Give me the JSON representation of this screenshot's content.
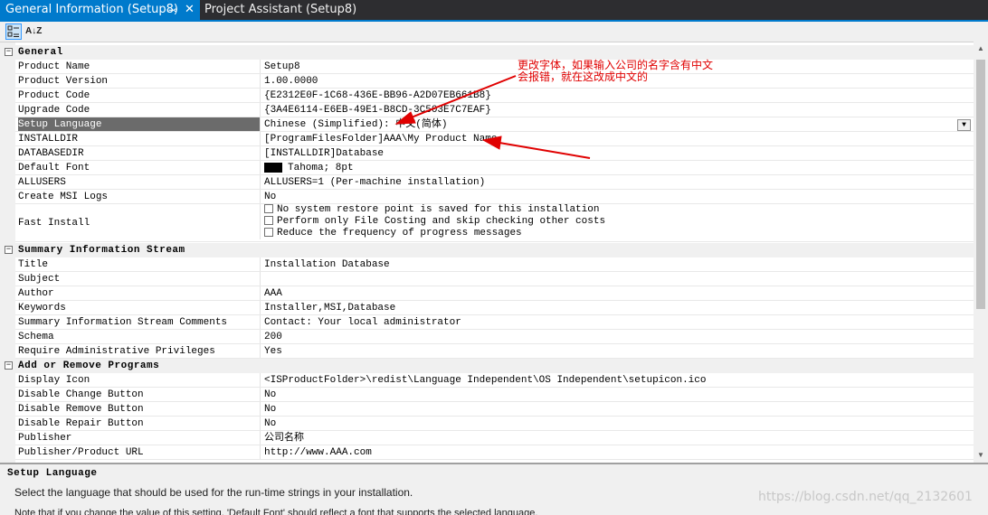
{
  "tabs": {
    "active_label": "General Information (Setup8)",
    "pin_glyph": "⊸",
    "close_glyph": "✕",
    "inactive_label": "Project Assistant (Setup8)"
  },
  "toolbar": {
    "categorized_icon": "categorized-icon",
    "alphabetical_label": "A↓Z"
  },
  "grid": {
    "sections": {
      "general": "General",
      "summary": "Summary Information Stream",
      "addremove": "Add or Remove Programs"
    },
    "general_rows": [
      {
        "name": "Product Name",
        "value": "Setup8"
      },
      {
        "name": "Product Version",
        "value": "1.00.0000"
      },
      {
        "name": "Product Code",
        "value": "{E2312E0F-1C68-436E-BB96-A2D07EB661B8}"
      },
      {
        "name": "Upgrade Code",
        "value": "{3A4E6114-E6EB-49E1-B8CD-3C503E7C7EAF}"
      },
      {
        "name": "Setup Language",
        "value": "Chinese (Simplified): 中文(简体)"
      },
      {
        "name": "INSTALLDIR",
        "value": "[ProgramFilesFolder]AAA\\My Product Name"
      },
      {
        "name": "DATABASEDIR",
        "value": "[INSTALLDIR]Database"
      },
      {
        "name": "Default Font",
        "value": "Tahoma; 8pt"
      },
      {
        "name": "ALLUSERS",
        "value": "ALLUSERS=1 (Per-machine installation)"
      },
      {
        "name": "Create MSI Logs",
        "value": "No"
      }
    ],
    "fast_install": {
      "name": "Fast Install",
      "options": [
        "No system restore point is saved for this installation",
        "Perform only File Costing and skip checking other costs",
        "Reduce the frequency of progress messages"
      ]
    },
    "summary_rows": [
      {
        "name": "Title",
        "value": "Installation Database"
      },
      {
        "name": "Subject",
        "value": ""
      },
      {
        "name": "Author",
        "value": "AAA"
      },
      {
        "name": "Keywords",
        "value": "Installer,MSI,Database"
      },
      {
        "name": "Summary Information Stream Comments",
        "value": "Contact:  Your local administrator"
      },
      {
        "name": "Schema",
        "value": "200"
      },
      {
        "name": "Require Administrative Privileges",
        "value": "Yes"
      }
    ],
    "addremove_rows": [
      {
        "name": "Display Icon",
        "value": "<ISProductFolder>\\redist\\Language Independent\\OS Independent\\setupicon.ico"
      },
      {
        "name": "Disable Change Button",
        "value": "No"
      },
      {
        "name": "Disable Remove Button",
        "value": "No"
      },
      {
        "name": "Disable Repair Button",
        "value": "No"
      },
      {
        "name": "Publisher",
        "value": "公司名称"
      },
      {
        "name": "Publisher/Product URL",
        "value": "http://www.AAA.com"
      }
    ]
  },
  "description": {
    "title": "Setup Language",
    "text": "Select the language that should be used for the run-time strings in your installation.",
    "cut_line": "Note that if you change the value of this setting, 'Default Font' should reflect a font that supports the selected language."
  },
  "annotation": {
    "line1": "更改字体，如果输入公司的名字含有中文",
    "line2": "会报错，就在这改成中文的",
    "color": "#e00000"
  },
  "watermark": "https://blog.csdn.net/qq_2132601"
}
